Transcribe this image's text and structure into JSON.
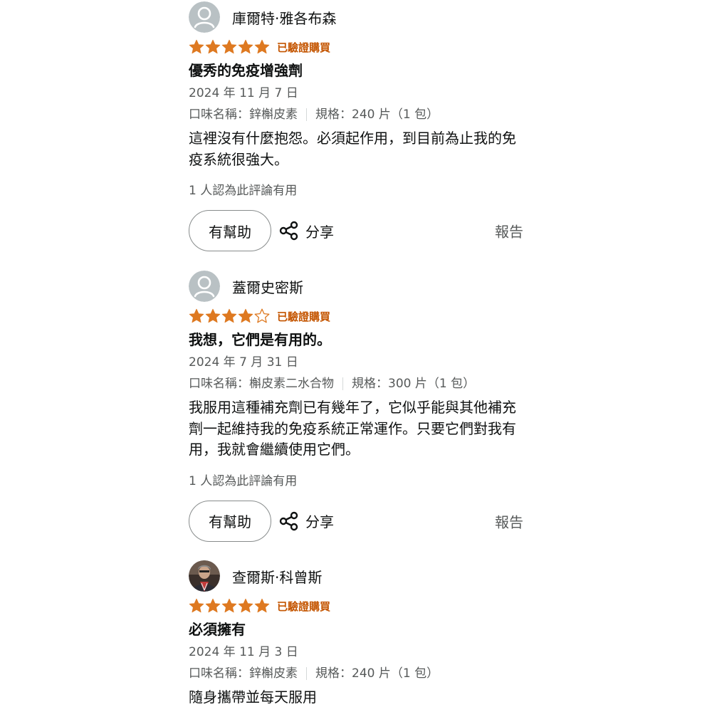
{
  "reviews": [
    {
      "reviewer_name": "庫爾特·雅各布森",
      "avatar": "default-avatar-icon",
      "rating": 5,
      "verified_label": "已驗證購買",
      "title": "優秀的免疫增強劑",
      "date": "2024 年 11 月 7 日",
      "flavor": "口味名稱：鋅槲皮素",
      "size": "規格：240 片（1 包）",
      "body": "這裡沒有什麼抱怨。必須起作用，到目前為止我的免疫系統很強大。",
      "helpful_count": "1 人認為此評論有用",
      "helpful_button": "有幫助",
      "share_label": "分享",
      "report_label": "報告"
    },
    {
      "reviewer_name": "蓋爾史密斯",
      "avatar": "default-avatar-icon",
      "rating": 4,
      "verified_label": "已驗證購買",
      "title": "我想，它們是有用的。",
      "date": "2024 年 7 月 31 日",
      "flavor": "口味名稱：槲皮素二水合物",
      "size": "規格：300 片（1 包）",
      "body": "我服用這種補充劑已有幾年了，它似乎能與其他補充劑一起維持我的免疫系統正常運作。只要它們對我有用，我就會繼續使用它們。",
      "helpful_count": "1 人認為此評論有用",
      "helpful_button": "有幫助",
      "share_label": "分享",
      "report_label": "報告"
    },
    {
      "reviewer_name": "查爾斯·科曾斯",
      "avatar": "profile-photo",
      "rating": 5,
      "verified_label": "已驗證購買",
      "title": "必須擁有",
      "date": "2024 年 11 月 3 日",
      "flavor": "口味名稱：鋅槲皮素",
      "size": "規格：240 片（1 包）",
      "body": "隨身攜帶並每天服用"
    }
  ],
  "colors": {
    "star": "#de7921",
    "verified": "#c45500",
    "text": "#0f1111",
    "muted": "#565959",
    "avatar_bg": "#b9c1c4"
  }
}
